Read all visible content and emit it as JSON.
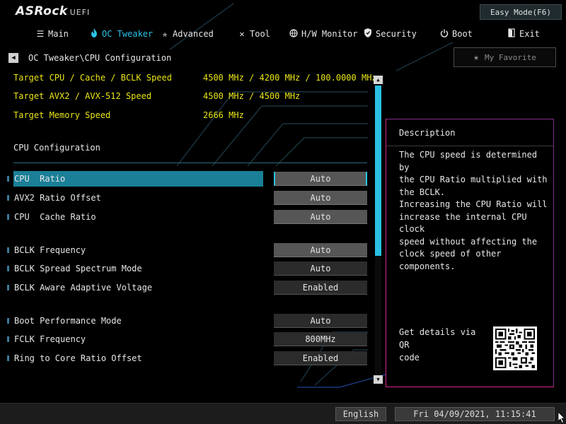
{
  "brand": {
    "logo": "ASRock",
    "sub": "UEFI"
  },
  "header": {
    "easy_mode_label": "Easy Mode(F6)"
  },
  "tabs": [
    {
      "id": "main",
      "label": "Main",
      "icon": "menu-lines-icon"
    },
    {
      "id": "oc-tweaker",
      "label": "OC Tweaker",
      "icon": "flame-icon",
      "active": true
    },
    {
      "id": "advanced",
      "label": "Advanced",
      "icon": "star-tool-icon"
    },
    {
      "id": "tool",
      "label": "Tool",
      "icon": "wrench-screwdriver-icon"
    },
    {
      "id": "hw-monitor",
      "label": "H/W Monitor",
      "icon": "globe-icon"
    },
    {
      "id": "security",
      "label": "Security",
      "icon": "shield-icon"
    },
    {
      "id": "boot",
      "label": "Boot",
      "icon": "power-icon"
    },
    {
      "id": "exit",
      "label": "Exit",
      "icon": "exit-door-icon"
    }
  ],
  "breadcrumb": {
    "path": "OC Tweaker\\CPU Configuration"
  },
  "favorite": {
    "label": "My Favorite"
  },
  "info": [
    {
      "label": "Target CPU / Cache / BCLK Speed",
      "value": "4500 MHz / 4200 MHz / 100.0000 MHz"
    },
    {
      "label": "Target AVX2 / AVX-512 Speed",
      "value": "4500 MHz / 4500 MHz"
    },
    {
      "label": "Target Memory Speed",
      "value": "2666 MHz"
    }
  ],
  "section": {
    "title": "CPU Configuration"
  },
  "options": [
    {
      "label": "CPU  Ratio",
      "value": "Auto",
      "selected": true,
      "style": "grey"
    },
    {
      "label": "AVX2 Ratio Offset",
      "value": "Auto",
      "style": "grey"
    },
    {
      "label": "CPU  Cache Ratio",
      "value": "Auto",
      "style": "grey"
    },
    {
      "label": "BCLK Frequency",
      "value": "Auto",
      "style": "grey"
    },
    {
      "label": "BCLK Spread Spectrum Mode",
      "value": "Auto",
      "style": "dark"
    },
    {
      "label": "BCLK Aware Adaptive Voltage",
      "value": "Enabled",
      "style": "dark"
    },
    {
      "label": "Boot Performance Mode",
      "value": "Auto",
      "style": "dark"
    },
    {
      "label": "FCLK Frequency",
      "value": "800MHz",
      "style": "dark"
    },
    {
      "label": "Ring to Core Ratio Offset",
      "value": "Enabled",
      "style": "dark"
    }
  ],
  "scroll": {
    "position_fraction": 0.0,
    "visible_fraction": 0.59
  },
  "description": {
    "title": "Description",
    "text": "The CPU speed is determined by\nthe CPU Ratio multiplied with\nthe BCLK.\nIncreasing the CPU Ratio will\nincrease the internal CPU clock\nspeed without affecting the\nclock speed of other components.",
    "qr_text": "Get details via QR\ncode"
  },
  "footer": {
    "language": "English",
    "datetime": "Fri 04/09/2021, 11:15:41"
  },
  "colors": {
    "accent": "#2ac3e6",
    "highlight_text": "#e8e416",
    "panel_border": "#d3288a",
    "selected_row": "#1a7f97"
  }
}
